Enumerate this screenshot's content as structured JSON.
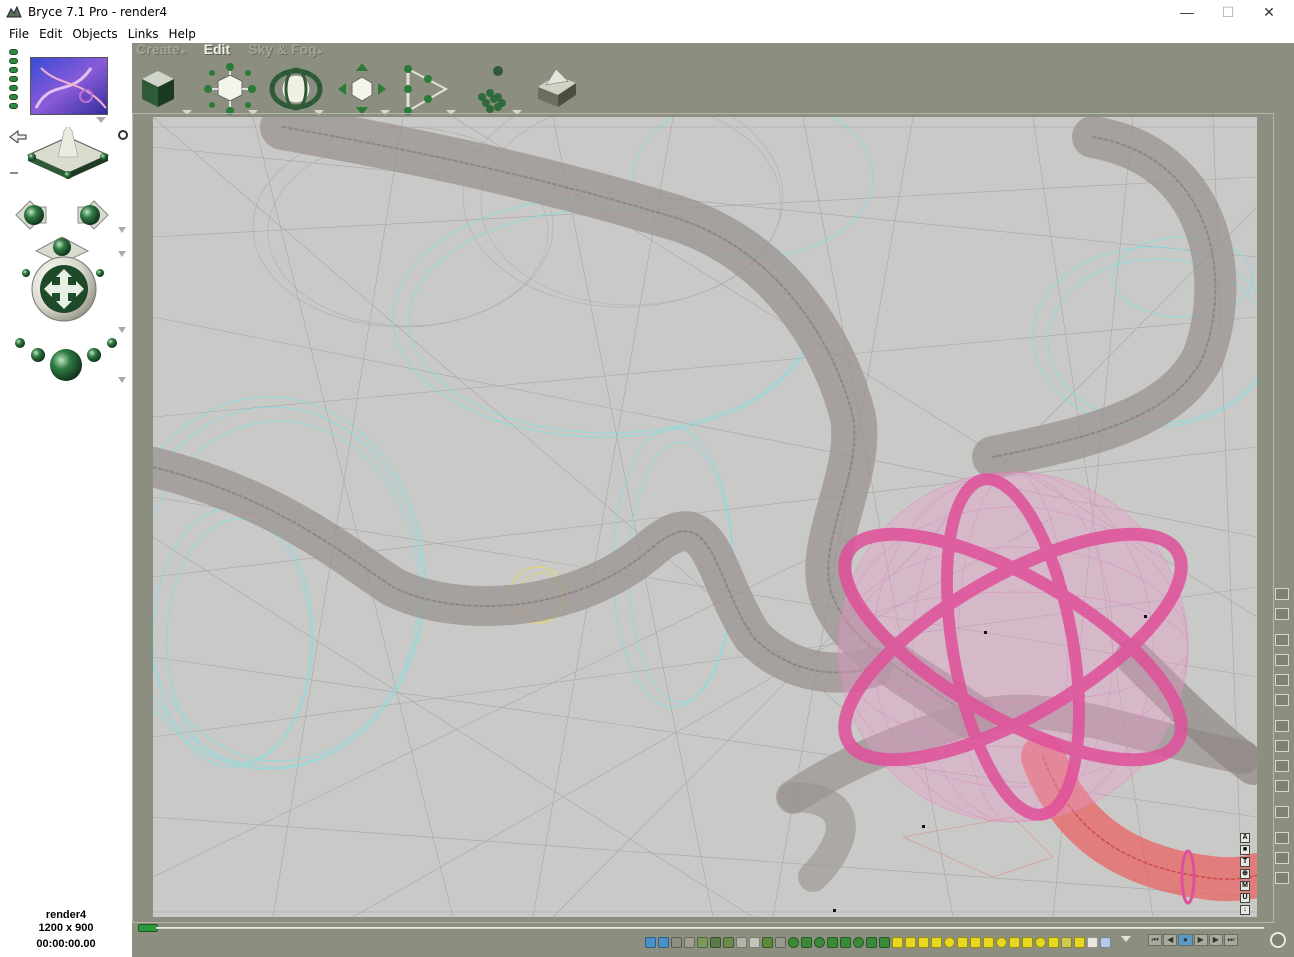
{
  "window": {
    "title": "Bryce 7.1  Pro - render4",
    "minimize": "—",
    "maximize": "☐",
    "close": "✕"
  },
  "menu": {
    "items": [
      "File",
      "Edit",
      "Objects",
      "Links",
      "Help"
    ]
  },
  "palette_tabs": [
    {
      "label": "Create",
      "active": false
    },
    {
      "label": "Edit",
      "active": true
    },
    {
      "label": "Sky & Fog",
      "active": false
    }
  ],
  "toolbar": {
    "tools": [
      {
        "name": "material-editor-icon"
      },
      {
        "name": "resize-transform-icon"
      },
      {
        "name": "rotate-transform-icon"
      },
      {
        "name": "reposition-transform-icon"
      },
      {
        "name": "align-icon"
      },
      {
        "name": "randomize-icon"
      },
      {
        "name": "terrain-editor-icon"
      }
    ]
  },
  "document": {
    "name": "render4",
    "size": "1200 x 900",
    "timecode": "00:00:00.00"
  },
  "letter_tools": [
    "A",
    "■",
    "T",
    "⊕",
    "M",
    "U",
    "↓"
  ],
  "colors": {
    "app_bg": "#8c8f80",
    "viewport_bg": "#c9c9c8",
    "wire_gray": "#8e8784",
    "wire_cyan": "#7fe0e0",
    "wire_pink": "#e0509a",
    "wire_red": "#ee5555",
    "accent_green": "#2a9a3a"
  }
}
